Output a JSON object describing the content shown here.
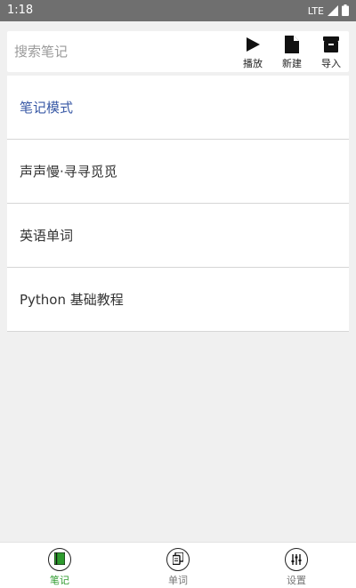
{
  "status": {
    "time": "1:18",
    "network": "LTE"
  },
  "search": {
    "placeholder": "搜索笔记"
  },
  "toolbar": {
    "play_label": "播放",
    "new_label": "新建",
    "import_label": "导入"
  },
  "notes": [
    {
      "title": "笔记模式"
    },
    {
      "title": "声声慢·寻寻觅觅"
    },
    {
      "title": "英语单词"
    },
    {
      "title": "Python 基础教程"
    }
  ],
  "nav": {
    "items": [
      {
        "label": "笔记",
        "icon": "notebook-icon",
        "active": true
      },
      {
        "label": "单词",
        "icon": "copy-icon",
        "active": false
      },
      {
        "label": "设置",
        "icon": "sliders-icon",
        "active": false
      }
    ],
    "active_color": "#2e9b2e"
  },
  "colors": {
    "status_bar": "#6f6f6f",
    "accent_text": "#3a5aa6"
  }
}
